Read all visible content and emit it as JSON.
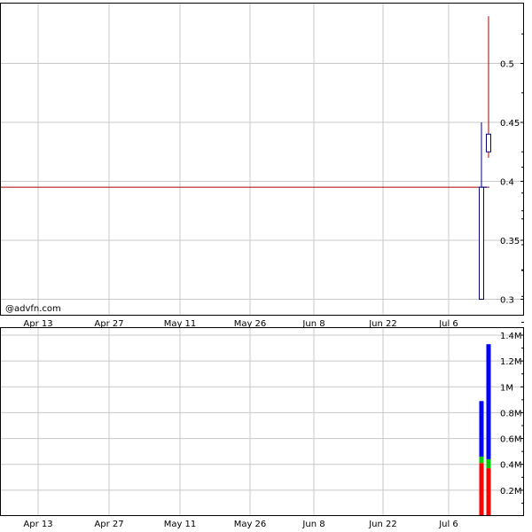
{
  "chart_data": [
    {
      "type": "candlestick",
      "title": "",
      "xlabel": "",
      "ylabel": "",
      "x_ticks": [
        "Apr 13",
        "Apr 27",
        "May 11",
        "May 26",
        "Jun 8",
        "Jun 22",
        "Jul 6"
      ],
      "y_ticks": [
        "0.3",
        "0.35",
        "0.4",
        "0.45",
        "0.5"
      ],
      "ylim": [
        0.29,
        0.55
      ],
      "grid": true,
      "reference_line": {
        "value": 0.395,
        "color": "#b00000"
      },
      "candles": [
        {
          "open": 0.3,
          "high": 0.45,
          "low": 0.3,
          "close": 0.395,
          "color": "#000080"
        },
        {
          "open": 0.425,
          "high": 0.54,
          "low": 0.42,
          "close": 0.44,
          "color": "#000080",
          "wick_color": "#b00000"
        }
      ],
      "watermark": "@advfn.com"
    },
    {
      "type": "bar",
      "title": "",
      "xlabel": "",
      "ylabel": "",
      "x_ticks": [
        "Apr 13",
        "Apr 27",
        "May 11",
        "May 26",
        "Jun 8",
        "Jun 22",
        "Jul 6"
      ],
      "y_ticks": [
        "0.2M",
        "0.4M",
        "0.6M",
        "0.8M",
        "1M",
        "1.2M",
        "1.4M"
      ],
      "ylim": [
        0,
        1.42
      ],
      "grid": true,
      "stacked": true,
      "units": "millions",
      "series": [
        {
          "color": "#ff0000",
          "values": [
            0.41,
            0.37
          ]
        },
        {
          "color": "#00cc00",
          "values": [
            0.05,
            0.07
          ]
        },
        {
          "color": "#0000ff",
          "values": [
            0.43,
            0.89
          ]
        }
      ]
    }
  ]
}
